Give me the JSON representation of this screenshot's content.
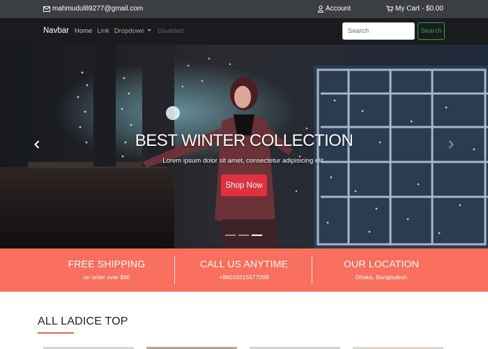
{
  "topbar": {
    "email": "mahmudul89277@gmail.com",
    "account": "Account",
    "cart": "My Cart - $0.00"
  },
  "navbar": {
    "brand": "Navbar",
    "links": [
      "Home",
      "Link",
      "Dropdown",
      "Disabled"
    ],
    "search_placeholder": "Search",
    "search_button": "Search"
  },
  "hero": {
    "title": "BEST WINTER COLLECTION",
    "subtitle": "Lorem ipsum dolor sit amet, consectetur adipisicing elit.",
    "button": "Shop Now",
    "active_slide": 3,
    "slide_count": 3
  },
  "info": [
    {
      "title": "FREE SHIPPING",
      "text": "on order over $90"
    },
    {
      "title": "CALL US ANYTIME",
      "text": "+88019215577009"
    },
    {
      "title": "OUR LOCATION",
      "text": "Dhaka, Bangladesh"
    }
  ],
  "section": {
    "title": "ALL LADICE TOP"
  },
  "colors": {
    "topbar": "#3b3f44",
    "navbar": "#1a1b1d",
    "accent_red": "#e0313f",
    "info_bg": "#f8705d",
    "search_green": "#28a745",
    "section_underline": "#e8693c"
  }
}
